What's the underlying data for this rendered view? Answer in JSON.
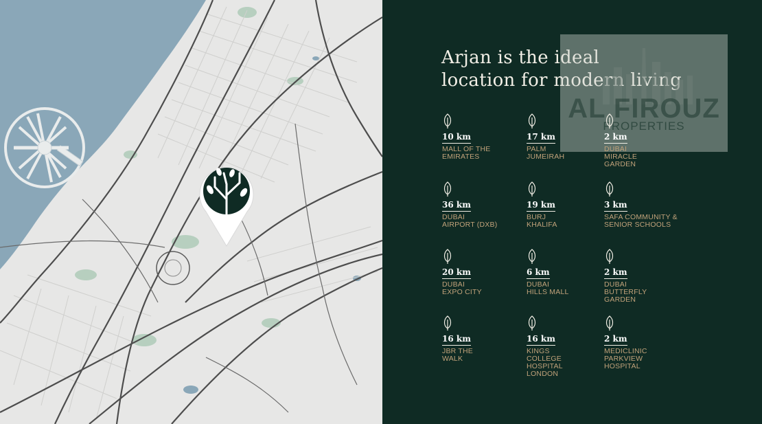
{
  "headline": {
    "line1": "Arjan is the ideal",
    "line2": "location for modern living"
  },
  "colors": {
    "panel_background": "#0f2b24",
    "heading_text": "#f2efe6",
    "label_text": "#c1a27a",
    "sea": "#8aa7b8",
    "map_land": "#e7e7e6",
    "pin_green": "#0f2b24"
  },
  "map": {
    "pin_icon": "tree-location-pin-icon"
  },
  "distances": [
    {
      "distance": "10 km",
      "place": "MALL OF THE\nEMIRATES"
    },
    {
      "distance": "17 km",
      "place": "PALM\nJUMEIRAH"
    },
    {
      "distance": "2 km",
      "place": "DUBAI\nMIRACLE\nGARDEN"
    },
    {
      "distance": "36 km",
      "place": "DUBAI\nAIRPORT (DXB)"
    },
    {
      "distance": "19 km",
      "place": "BURJ\nKHALIFA"
    },
    {
      "distance": "3 km",
      "place": "SAFA COMMUNITY &\nSENIOR SCHOOLS"
    },
    {
      "distance": "20 km",
      "place": "DUBAI\nEXPO CITY"
    },
    {
      "distance": "6 km",
      "place": "DUBAI\nHILLS MALL"
    },
    {
      "distance": "2 km",
      "place": "DUBAI\nBUTTERFLY\nGARDEN"
    },
    {
      "distance": "16 km",
      "place": "JBR THE\nWALK"
    },
    {
      "distance": "16 km",
      "place": "KINGS\nCOLLEGE\nHOSPITAL\nLONDON"
    },
    {
      "distance": "2 km",
      "place": "MEDICLINIC\nPARKVIEW\nHOSPITAL"
    }
  ],
  "watermark": {
    "name": "AL FIROUZ",
    "subtitle": "PROPERTIES"
  }
}
